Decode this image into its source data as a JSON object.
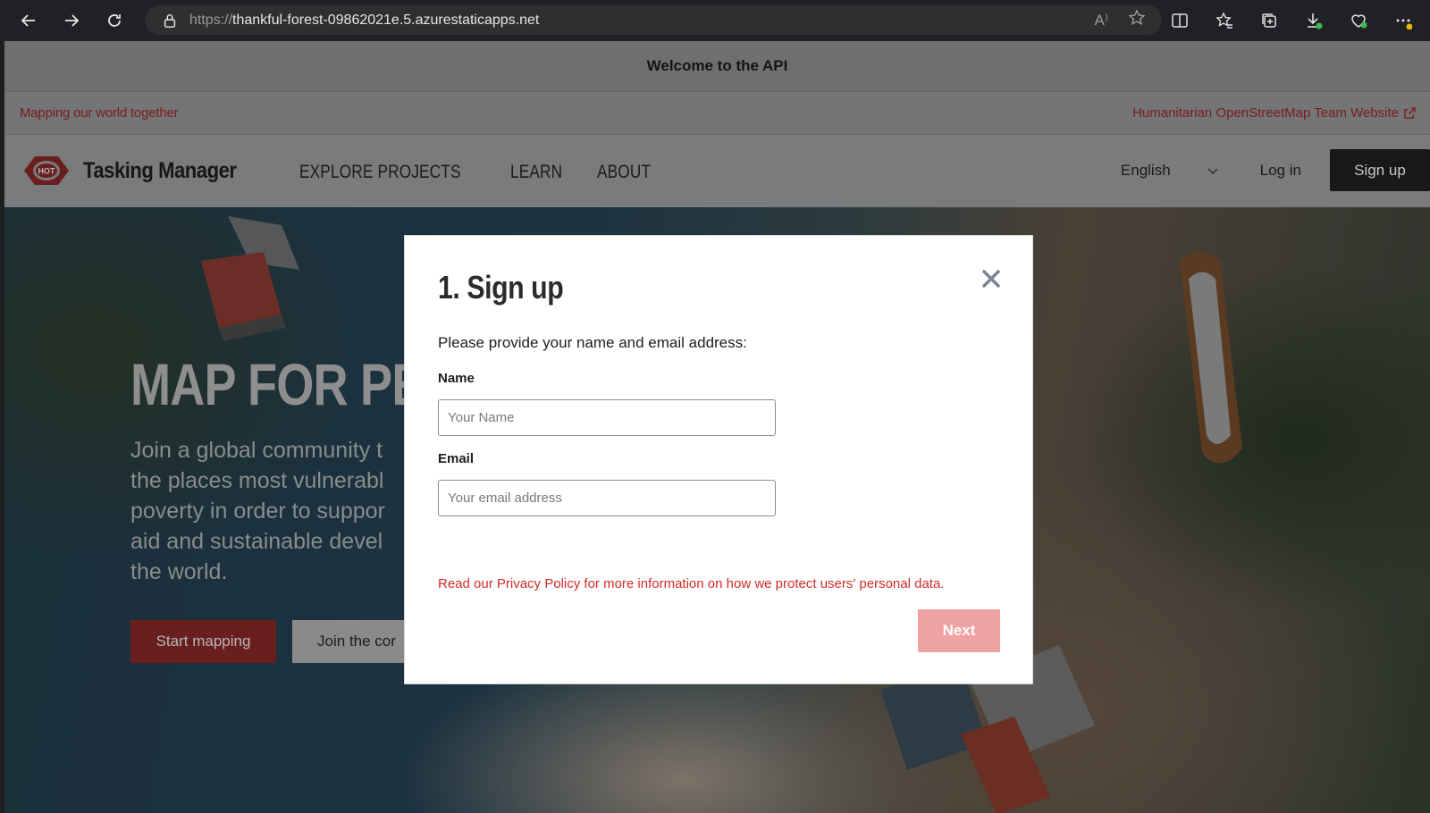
{
  "browser": {
    "url_protocol": "https://",
    "url_host": "thankful-forest-09862021e.5.azurestaticapps.net",
    "read_aloud_label": "A⁾"
  },
  "page": {
    "api_banner": "Welcome to the API",
    "tagline": "Mapping our world together",
    "hot_link": "Humanitarian OpenStreetMap Team Website",
    "logo_badge": "HOT",
    "logo_text": "Tasking Manager",
    "nav": {
      "items": [
        {
          "label": "EXPLORE PROJECTS"
        },
        {
          "label": "LEARN"
        },
        {
          "label": "ABOUT"
        }
      ],
      "language": "English",
      "login": "Log in",
      "signup": "Sign up"
    },
    "hero": {
      "title": "MAP FOR PE",
      "text_lines": [
        "Join a global community t",
        "the places most vulnerabl",
        "poverty in order to suppor",
        "aid and sustainable devel",
        "the world."
      ],
      "start_button": "Start mapping",
      "join_button": "Join the cor"
    }
  },
  "modal": {
    "title": "1. Sign up",
    "description": "Please provide your name and email address:",
    "name_label": "Name",
    "name_placeholder": "Your Name",
    "email_label": "Email",
    "email_placeholder": "Your email address",
    "privacy_prefix": "Read our ",
    "privacy_link": "Privacy Policy",
    "privacy_suffix": " for more information on how we protect users' personal data.",
    "next_button": "Next"
  },
  "colors": {
    "brand_red": "#d73f3f",
    "privacy_text": "#d42a2a",
    "next_disabled": "#eea2a2"
  }
}
